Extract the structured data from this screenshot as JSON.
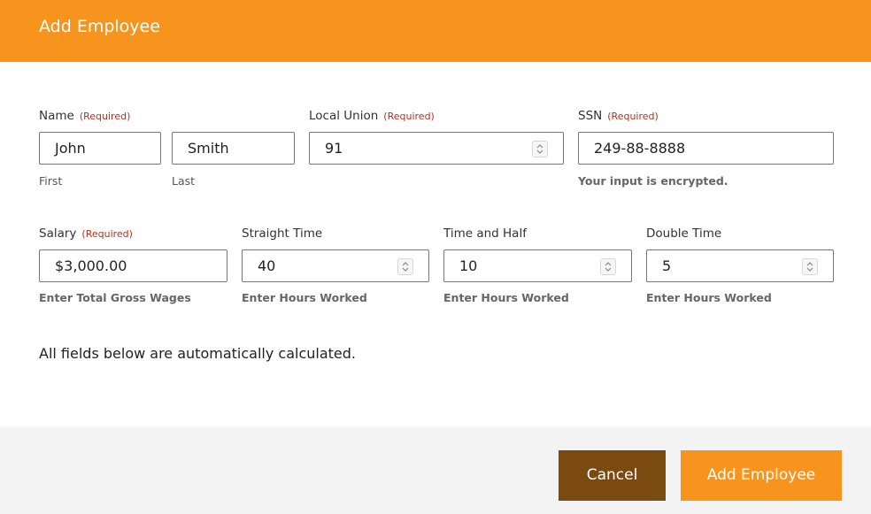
{
  "header": {
    "title": "Add Employee"
  },
  "required_text": "(Required)",
  "name": {
    "label": "Name",
    "first": {
      "value": "John",
      "sub": "First"
    },
    "last": {
      "value": "Smith",
      "sub": "Last"
    }
  },
  "union": {
    "label": "Local Union",
    "value": "91"
  },
  "ssn": {
    "label": "SSN",
    "value": "249-88-8888",
    "hint": "Your input is encrypted."
  },
  "salary": {
    "label": "Salary",
    "value": "$3,000.00",
    "hint": "Enter Total Gross Wages"
  },
  "straight": {
    "label": "Straight Time",
    "value": "40",
    "hint": "Enter Hours Worked"
  },
  "half": {
    "label": "Time and Half",
    "value": "10",
    "hint": "Enter Hours Worked"
  },
  "double": {
    "label": "Double Time",
    "value": "5",
    "hint": "Enter Hours Worked"
  },
  "info_text": "All fields below are automatically calculated.",
  "buttons": {
    "cancel": "Cancel",
    "add": "Add Employee"
  },
  "colors": {
    "header": "#f7941d",
    "cancel": "#7a4a10",
    "add": "#f7941d",
    "required": "#b5301e"
  }
}
